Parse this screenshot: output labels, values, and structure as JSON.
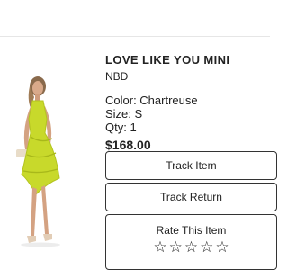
{
  "product": {
    "title": "LOVE LIKE YOU MINI",
    "brand": "NBD",
    "color": "Color: Chartreuse",
    "size": "Size: S",
    "qty": "Qty: 1",
    "price": "$168.00",
    "dress_color": "#c8d92b"
  },
  "actions": {
    "track_item_label": "Track Item",
    "track_return_label": "Track Return"
  },
  "rating": {
    "label": "Rate This Item",
    "stars": [
      "☆",
      "☆",
      "☆",
      "☆",
      "☆"
    ],
    "value": 0,
    "max": 5
  }
}
